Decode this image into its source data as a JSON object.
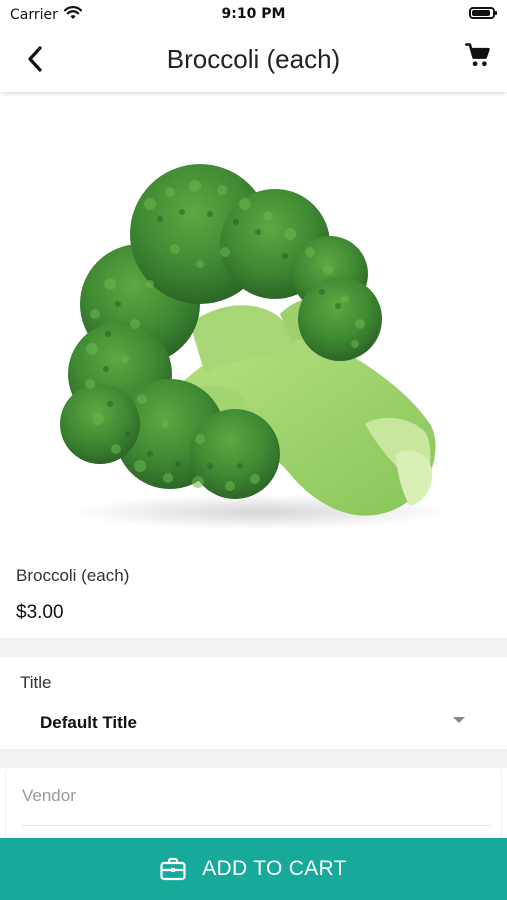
{
  "status_bar": {
    "carrier": "Carrier",
    "time": "9:10 PM"
  },
  "header": {
    "title": "Broccoli (each)"
  },
  "product": {
    "name": "Broccoli (each)",
    "price": "$3.00"
  },
  "variant": {
    "label": "Title",
    "selected": "Default Title"
  },
  "vendor": {
    "label": "Vendor"
  },
  "actions": {
    "add_to_cart": "ADD TO CART"
  },
  "icons": {
    "back": "chevron-left-icon",
    "cart": "shopping-cart-icon",
    "wifi": "wifi-icon",
    "battery": "battery-icon",
    "add_to_cart": "briefcase-icon"
  },
  "colors": {
    "accent": "#17aa9a",
    "text_primary": "#111111",
    "text_muted": "#9a9a9a",
    "background_gap": "#f2f2f2",
    "broccoli_dark": "#2f6f2a",
    "broccoli_light": "#9bd36a"
  }
}
